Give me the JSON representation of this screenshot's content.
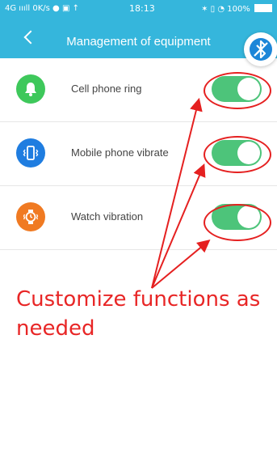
{
  "status_bar": {
    "left": "4G ıııll 0K/s ● ▣ ↑",
    "time": "18:13",
    "right": "✶ ▯ ◔ 100%"
  },
  "header": {
    "title": "Management of equipment",
    "back_icon": "chevron-left-icon",
    "action_icon": "bluetooth-off-icon"
  },
  "settings": [
    {
      "label": "Cell phone ring",
      "icon": "bell-icon",
      "icon_color": "#3ec85b",
      "enabled": true
    },
    {
      "label": "Mobile phone vibrate",
      "icon": "phone-vibrate-icon",
      "icon_color": "#1f7de0",
      "enabled": true
    },
    {
      "label": "Watch vibration",
      "icon": "watch-vibrate-icon",
      "icon_color": "#f07a22",
      "enabled": true
    }
  ],
  "annotation": {
    "text": "Customize functions as needed",
    "color": "#e82626"
  },
  "colors": {
    "header": "#35b6dc",
    "toggle_on": "#4dc47a"
  }
}
